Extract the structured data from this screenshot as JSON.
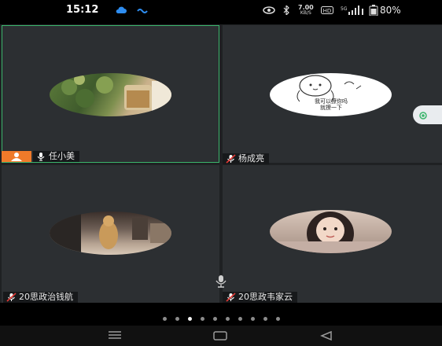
{
  "status_bar": {
    "time": "15:12",
    "net_speed": "7.00",
    "net_unit": "KB/S",
    "battery": "80%",
    "icons": [
      "cloud-icon",
      "wave-icon",
      "eye-icon",
      "bluetooth-icon",
      "hd-icon",
      "signal-icon",
      "battery-icon"
    ]
  },
  "participants": [
    {
      "name": "任小美",
      "role": "host",
      "mic": "on",
      "active": true,
      "avatar": "foliage-and-cup-photo"
    },
    {
      "name": "杨成亮",
      "role": "participant",
      "mic": "muted",
      "avatar": "cartoon-sticker",
      "sticker_text": [
        "我可以撩你吗",
        "就撩一下"
      ]
    },
    {
      "name": "20思政治钱航",
      "role": "participant",
      "mic": "muted",
      "avatar": "cat-photo"
    },
    {
      "name": "20思政韦家云",
      "role": "participant",
      "mic": "muted",
      "avatar": "girl-portrait-photo"
    }
  ],
  "pager": {
    "total": 10,
    "current": 3
  },
  "colors": {
    "active_border": "#3bb56c",
    "host_badge": "#ef7a2a",
    "tile_bg": "#2c2f32"
  },
  "nav": [
    "menu-icon",
    "home-icon",
    "back-icon"
  ]
}
